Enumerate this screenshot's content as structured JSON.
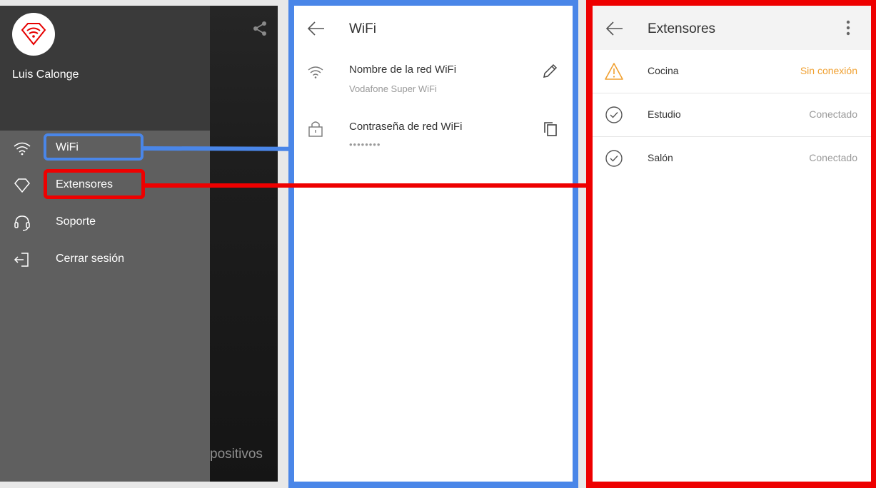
{
  "drawer": {
    "user_name": "Luis Calonge",
    "items": [
      {
        "label": "WiFi",
        "icon": "wifi-icon"
      },
      {
        "label": "Extensores",
        "icon": "extender-icon"
      },
      {
        "label": "Soporte",
        "icon": "headset-icon"
      },
      {
        "label": "Cerrar sesión",
        "icon": "logout-icon"
      }
    ],
    "background_text": "positivos"
  },
  "wifi_screen": {
    "title": "WiFi",
    "network_name_label": "Nombre de la red WiFi",
    "network_name_value": "Vodafone Super WiFi",
    "password_label": "Contraseña de red WiFi",
    "password_value": "••••••••"
  },
  "extensores_screen": {
    "title": "Extensores",
    "items": [
      {
        "name": "Cocina",
        "status": "Sin conexión",
        "icon": "warning-icon"
      },
      {
        "name": "Estudio",
        "status": "Conectado",
        "icon": "check-circle-icon"
      },
      {
        "name": "Salón",
        "status": "Conectado",
        "icon": "check-circle-icon"
      }
    ]
  },
  "colors": {
    "highlight_blue": "#4a86e8",
    "highlight_red": "#ee0000",
    "warning_orange": "#f0a030",
    "brand_red": "#e60000"
  }
}
